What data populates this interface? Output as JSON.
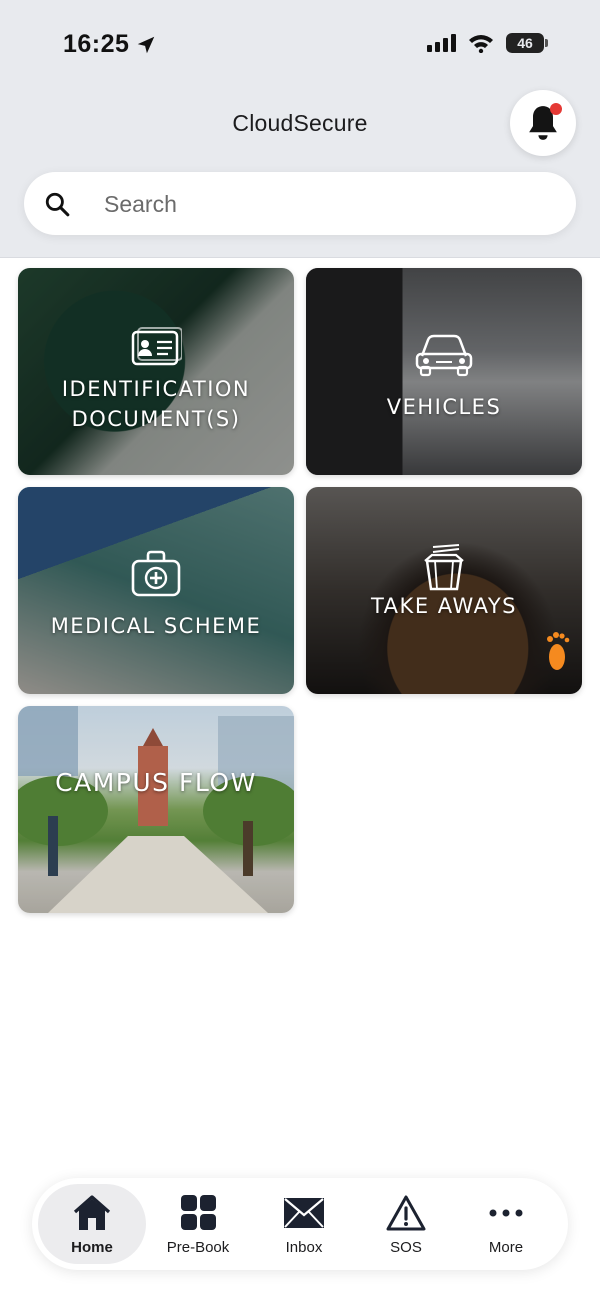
{
  "status_bar": {
    "time": "16:25",
    "battery_level": "46"
  },
  "header": {
    "title": "CloudSecure"
  },
  "search": {
    "placeholder": "Search"
  },
  "tiles": [
    {
      "label": "IDENTIFICATION DOCUMENT(S)",
      "icon": "id-card-icon"
    },
    {
      "label": "VEHICLES",
      "icon": "car-icon"
    },
    {
      "label": "MEDICAL SCHEME",
      "icon": "medical-kit-icon"
    },
    {
      "label": "TAKE AWAYS",
      "icon": "takeaway-box-icon"
    },
    {
      "label": "CAMPUS FLOW",
      "icon": ""
    }
  ],
  "bottom_nav": {
    "items": [
      {
        "label": "Home",
        "icon": "home-icon",
        "active": true
      },
      {
        "label": "Pre-Book",
        "icon": "grid-icon",
        "active": false
      },
      {
        "label": "Inbox",
        "icon": "envelope-icon",
        "active": false
      },
      {
        "label": "SOS",
        "icon": "warning-icon",
        "active": false
      },
      {
        "label": "More",
        "icon": "ellipsis-icon",
        "active": false
      }
    ]
  },
  "colors": {
    "header_bg": "#e8eaee",
    "notification_dot": "#e53935",
    "active_nav_bg": "#ececee"
  }
}
